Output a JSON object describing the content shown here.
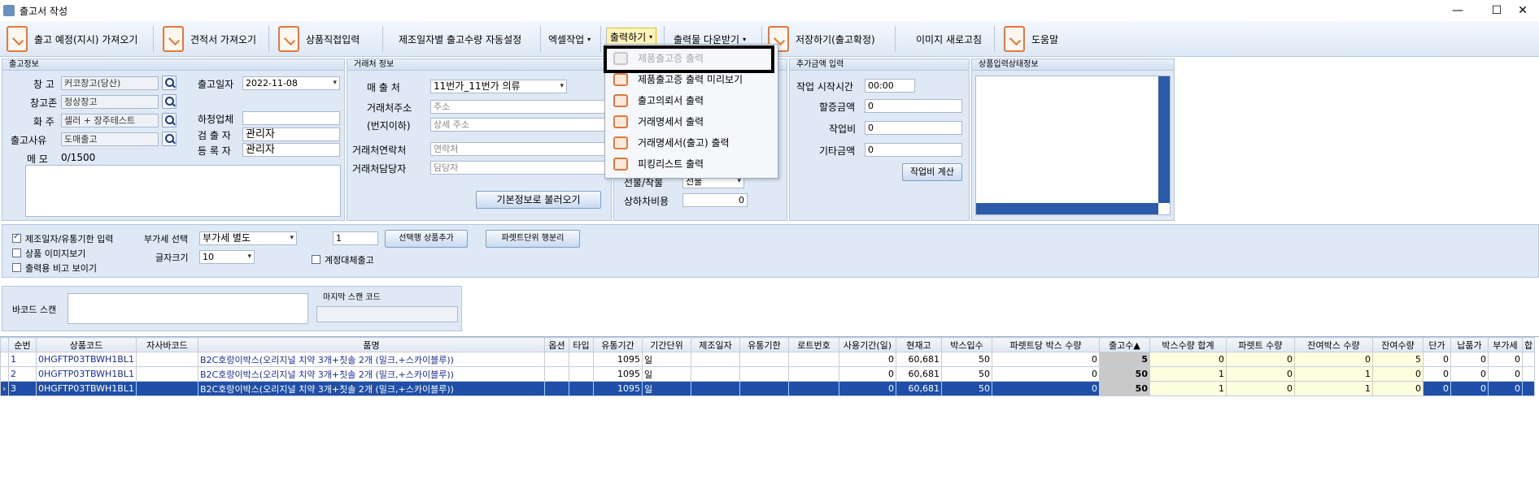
{
  "window": {
    "title": "출고서 작성",
    "min": "—",
    "max": "☐",
    "close": "✕"
  },
  "toolbar": {
    "import_plan": "출고 예정(지시) 가져오기",
    "import_quote": "견적서 가져오기",
    "direct_input": "상품직접입력",
    "auto_qty": "제조일자별 출고수량 자동설정",
    "excel": "엑셀작업",
    "print": "출력하기",
    "download": "출력물 다운받기",
    "save": "저장하기(출고확정)",
    "refresh_image": "이미지 새로고침",
    "help": "도움말"
  },
  "print_menu": [
    {
      "label": "제품출고증 출력",
      "disabled": true
    },
    {
      "label": "제품출고증 출력 미리보기",
      "disabled": false
    },
    {
      "label": "출고의뢰서 출력",
      "disabled": false
    },
    {
      "label": "거래명세서 출력",
      "disabled": false
    },
    {
      "label": "거래명세서(출고) 출력",
      "disabled": false
    },
    {
      "label": "피킹리스트 출력",
      "disabled": false
    }
  ],
  "shipment": {
    "header": "출고정보",
    "warehouse_label": "창 고",
    "warehouse": "커코창고(당산)",
    "zone_label": "창고존",
    "zone": "정상창고",
    "owner_label": "화 주",
    "owner": "셀러 + 장주테스트",
    "reason_label": "출고사유",
    "reason": "도매출고",
    "memo_label": "메 모",
    "memo_count": "0/1500",
    "date_label": "출고일자",
    "date": "2022-11-08",
    "subcontract_label": "하청업체",
    "subcontract": "",
    "inspector_label": "검 출 자",
    "inspector": "관리자",
    "registrar_label": "등 록 자",
    "registrar": "관리자"
  },
  "client": {
    "header": "거래처 정보",
    "seller_label": "매 출 처",
    "seller": "11번가_11번가 의류",
    "address_label": "거래처주소",
    "address_ph": "주소",
    "address2_label": "(번지이하)",
    "address2_ph": "상세 주소",
    "contact_label": "거래처연락처",
    "contact_ph": "연락처",
    "manager_label": "거래처담당자",
    "manager_ph": "담당자",
    "load_btn": "기본정보로 불러오기"
  },
  "delivery": {
    "prepay_label": "선불/착불",
    "prepay": "선불",
    "extra_label": "상하차비용",
    "extra": "0"
  },
  "additional": {
    "header": "추가금액 입력",
    "start_label": "작업 시작시간",
    "start": "00:00",
    "surcharge_label": "할증금액",
    "surcharge": "0",
    "work_label": "작업비",
    "work": "0",
    "other_label": "기타금액",
    "other": "0",
    "calc_btn": "작업비 계산"
  },
  "status": {
    "header": "상품입력상태정보"
  },
  "options": {
    "mfg_check": "제조일자/유통기한 입력",
    "img_check": "상품 이미지보기",
    "compare_check": "출력용 비고 보이기",
    "vat_label": "부가세 선택",
    "vat": "부가세 별도",
    "font_label": "글자크기",
    "font": "10",
    "qty": "1",
    "replace_check": "계정대체출고",
    "add_btn": "선택행 상품추가",
    "split_btn": "파렛트단위 행분리"
  },
  "barcode": {
    "label": "바코드 스캔",
    "last_label": "마지막 스캔 코드"
  },
  "grid": {
    "headers": [
      "순번",
      "상품코드",
      "자사바코드",
      "품명",
      "옵션",
      "타입",
      "유통기간",
      "기간단위",
      "제조일자",
      "유통기한",
      "로트번호",
      "사용기간(일)",
      "현재고",
      "박스입수",
      "파렛트당 박스 수량",
      "출고수▲",
      "박스수량 합계",
      "파렛트 수량",
      "잔여박스 수량",
      "잔여수량",
      "단가",
      "납품가",
      "부가세",
      "합"
    ],
    "rows": [
      [
        "1",
        "0HGFTP03TBWH1BL1",
        "",
        "B2C호랑이박스(오리지널 치약 3개+칫솔 2개 (밀크,+스카이블루))",
        "",
        "",
        "1095",
        "일",
        "",
        "",
        "",
        "0",
        "60,681",
        "50",
        "0",
        "5",
        "0",
        "0",
        "0",
        "5",
        "0",
        "0",
        "0",
        ""
      ],
      [
        "2",
        "0HGFTP03TBWH1BL1",
        "",
        "B2C호랑이박스(오리지널 치약 3개+칫솔 2개 (밀크,+스카이블루))",
        "",
        "",
        "1095",
        "일",
        "",
        "",
        "",
        "0",
        "60,681",
        "50",
        "0",
        "50",
        "1",
        "0",
        "1",
        "0",
        "0",
        "0",
        "0",
        ""
      ],
      [
        "3",
        "0HGFTP03TBWH1BL1",
        "",
        "B2C호랑이박스(오리지널 치약 3개+칫솔 2개 (밀크,+스카이블루))",
        "",
        "",
        "1095",
        "일",
        "",
        "",
        "",
        "0",
        "60,681",
        "50",
        "0",
        "50",
        "1",
        "0",
        "1",
        "0",
        "0",
        "0",
        "0",
        ""
      ]
    ]
  }
}
